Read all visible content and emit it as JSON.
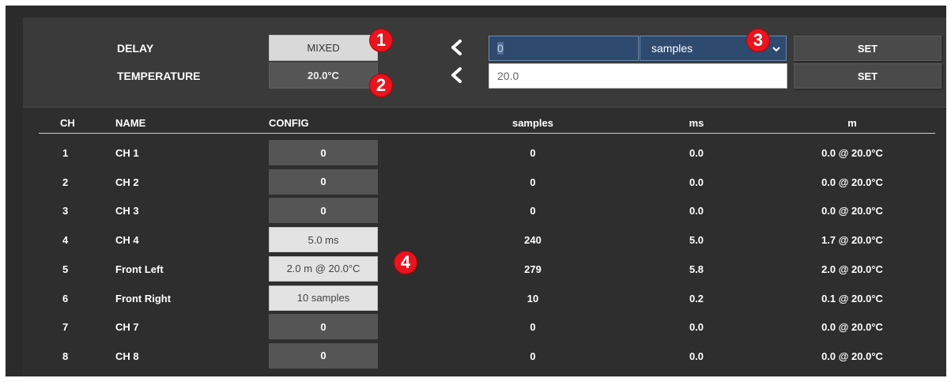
{
  "delay": {
    "label": "DELAY",
    "mode_value": "MIXED",
    "input_value": "0",
    "unit": "samples",
    "set_label": "SET"
  },
  "temperature": {
    "label": "TEMPERATURE",
    "value": "20.0°C",
    "input_value": "20.0",
    "set_label": "SET"
  },
  "badges": [
    "1",
    "2",
    "3",
    "4"
  ],
  "table": {
    "headers": [
      "CH",
      "NAME",
      "CONFIG",
      "samples",
      "ms",
      "m"
    ],
    "rows": [
      {
        "ch": "1",
        "name": "CH 1",
        "config": "0",
        "samples": "0",
        "ms": "0.0",
        "m": "0.0 @ 20.0°C",
        "style": "dark"
      },
      {
        "ch": "2",
        "name": "CH 2",
        "config": "0",
        "samples": "0",
        "ms": "0.0",
        "m": "0.0 @ 20.0°C",
        "style": "dark"
      },
      {
        "ch": "3",
        "name": "CH 3",
        "config": "0",
        "samples": "0",
        "ms": "0.0",
        "m": "0.0 @ 20.0°C",
        "style": "dark"
      },
      {
        "ch": "4",
        "name": "CH 4",
        "config": "5.0 ms",
        "samples": "240",
        "ms": "5.0",
        "m": "1.7 @ 20.0°C",
        "style": "light"
      },
      {
        "ch": "5",
        "name": "Front Left",
        "config": "2.0 m @ 20.0°C",
        "samples": "279",
        "ms": "5.8",
        "m": "2.0 @ 20.0°C",
        "style": "light"
      },
      {
        "ch": "6",
        "name": "Front Right",
        "config": "10 samples",
        "samples": "10",
        "ms": "0.2",
        "m": "0.1 @ 20.0°C",
        "style": "light"
      },
      {
        "ch": "7",
        "name": "CH 7",
        "config": "0",
        "samples": "0",
        "ms": "0.0",
        "m": "0.0 @ 20.0°C",
        "style": "dark"
      },
      {
        "ch": "8",
        "name": "CH 8",
        "config": "0",
        "samples": "0",
        "ms": "0.0",
        "m": "0.0 @ 20.0°C",
        "style": "dark"
      }
    ]
  },
  "icons": {
    "back": "chevron-left-icon",
    "dropdown": "chevron-down-icon"
  },
  "colors": {
    "badge": "#e8141e",
    "field_blue": "#2e4a6e",
    "panel": "#3a3a3a",
    "background": "#2b2b2b"
  }
}
